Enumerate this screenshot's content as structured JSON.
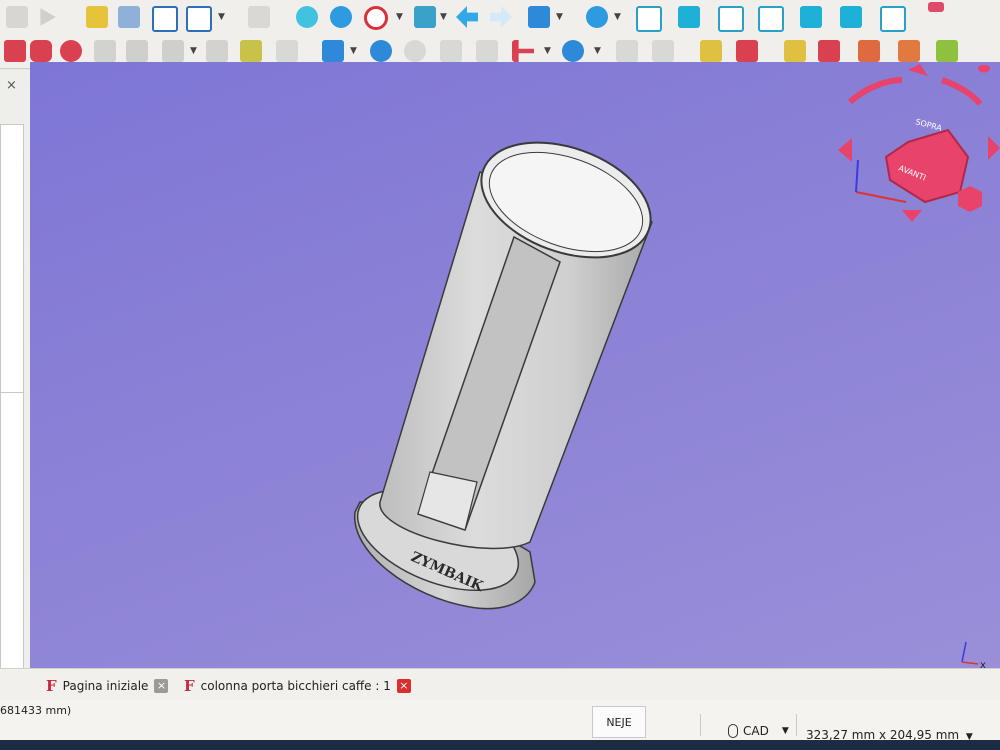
{
  "toolbar_row1": {
    "icons": [
      "grayed-icon",
      "play-icon",
      "new-part-icon",
      "open-folder-icon",
      "export-icon",
      "import-icon",
      "whats-this-icon",
      "fit-all-icon",
      "zoom-icon",
      "no-draw-style-icon",
      "stereo-icon",
      "back-arrow-icon",
      "forward-arrow-icon",
      "std-views-icon",
      "measure-icon",
      "iso-view-icon",
      "front-view-icon",
      "top-view-icon",
      "right-view-icon",
      "rear-view-icon",
      "bottom-view-icon",
      "left-view-icon"
    ]
  },
  "toolbar_row2": {
    "icons": [
      "box-icon",
      "cylinder-icon",
      "sphere-icon",
      "extrude-icon",
      "revolve-icon",
      "mirror-icon",
      "fillet-icon",
      "chamfer-icon",
      "ruled-surface-icon",
      "loft-icon",
      "sweep-icon",
      "section-icon",
      "cross-sections-icon",
      "offset-icon",
      "thickness-icon",
      "compound-icon",
      "boolean-icon",
      "cut-icon",
      "fuse-icon",
      "common-icon",
      "check-geometry-icon",
      "defeaturing-icon",
      "shape-builder-icon",
      "attachment-icon"
    ]
  },
  "navcube": {
    "top_label": "SOPRA",
    "front_label": "AVANTI",
    "axis_label": "x"
  },
  "model": {
    "engraved_text": "ZYMBAIK"
  },
  "tabs": [
    {
      "label": "Pagina iniziale",
      "close": "×"
    },
    {
      "label": "colonna porta bicchieri caffe : 1",
      "close": "×"
    }
  ],
  "status": {
    "left_text": "681433 mm)",
    "neje_button": "NEJE",
    "nav_style": "CAD",
    "dimensions": "323,27 mm x 204,95 mm"
  },
  "colors": {
    "viewport_top": "#7e76d6",
    "viewport_bottom": "#9a8fd8",
    "navcube": "#e8436a",
    "tab_close_active": "#d9302f",
    "freecad_logo": "#c8283a"
  }
}
